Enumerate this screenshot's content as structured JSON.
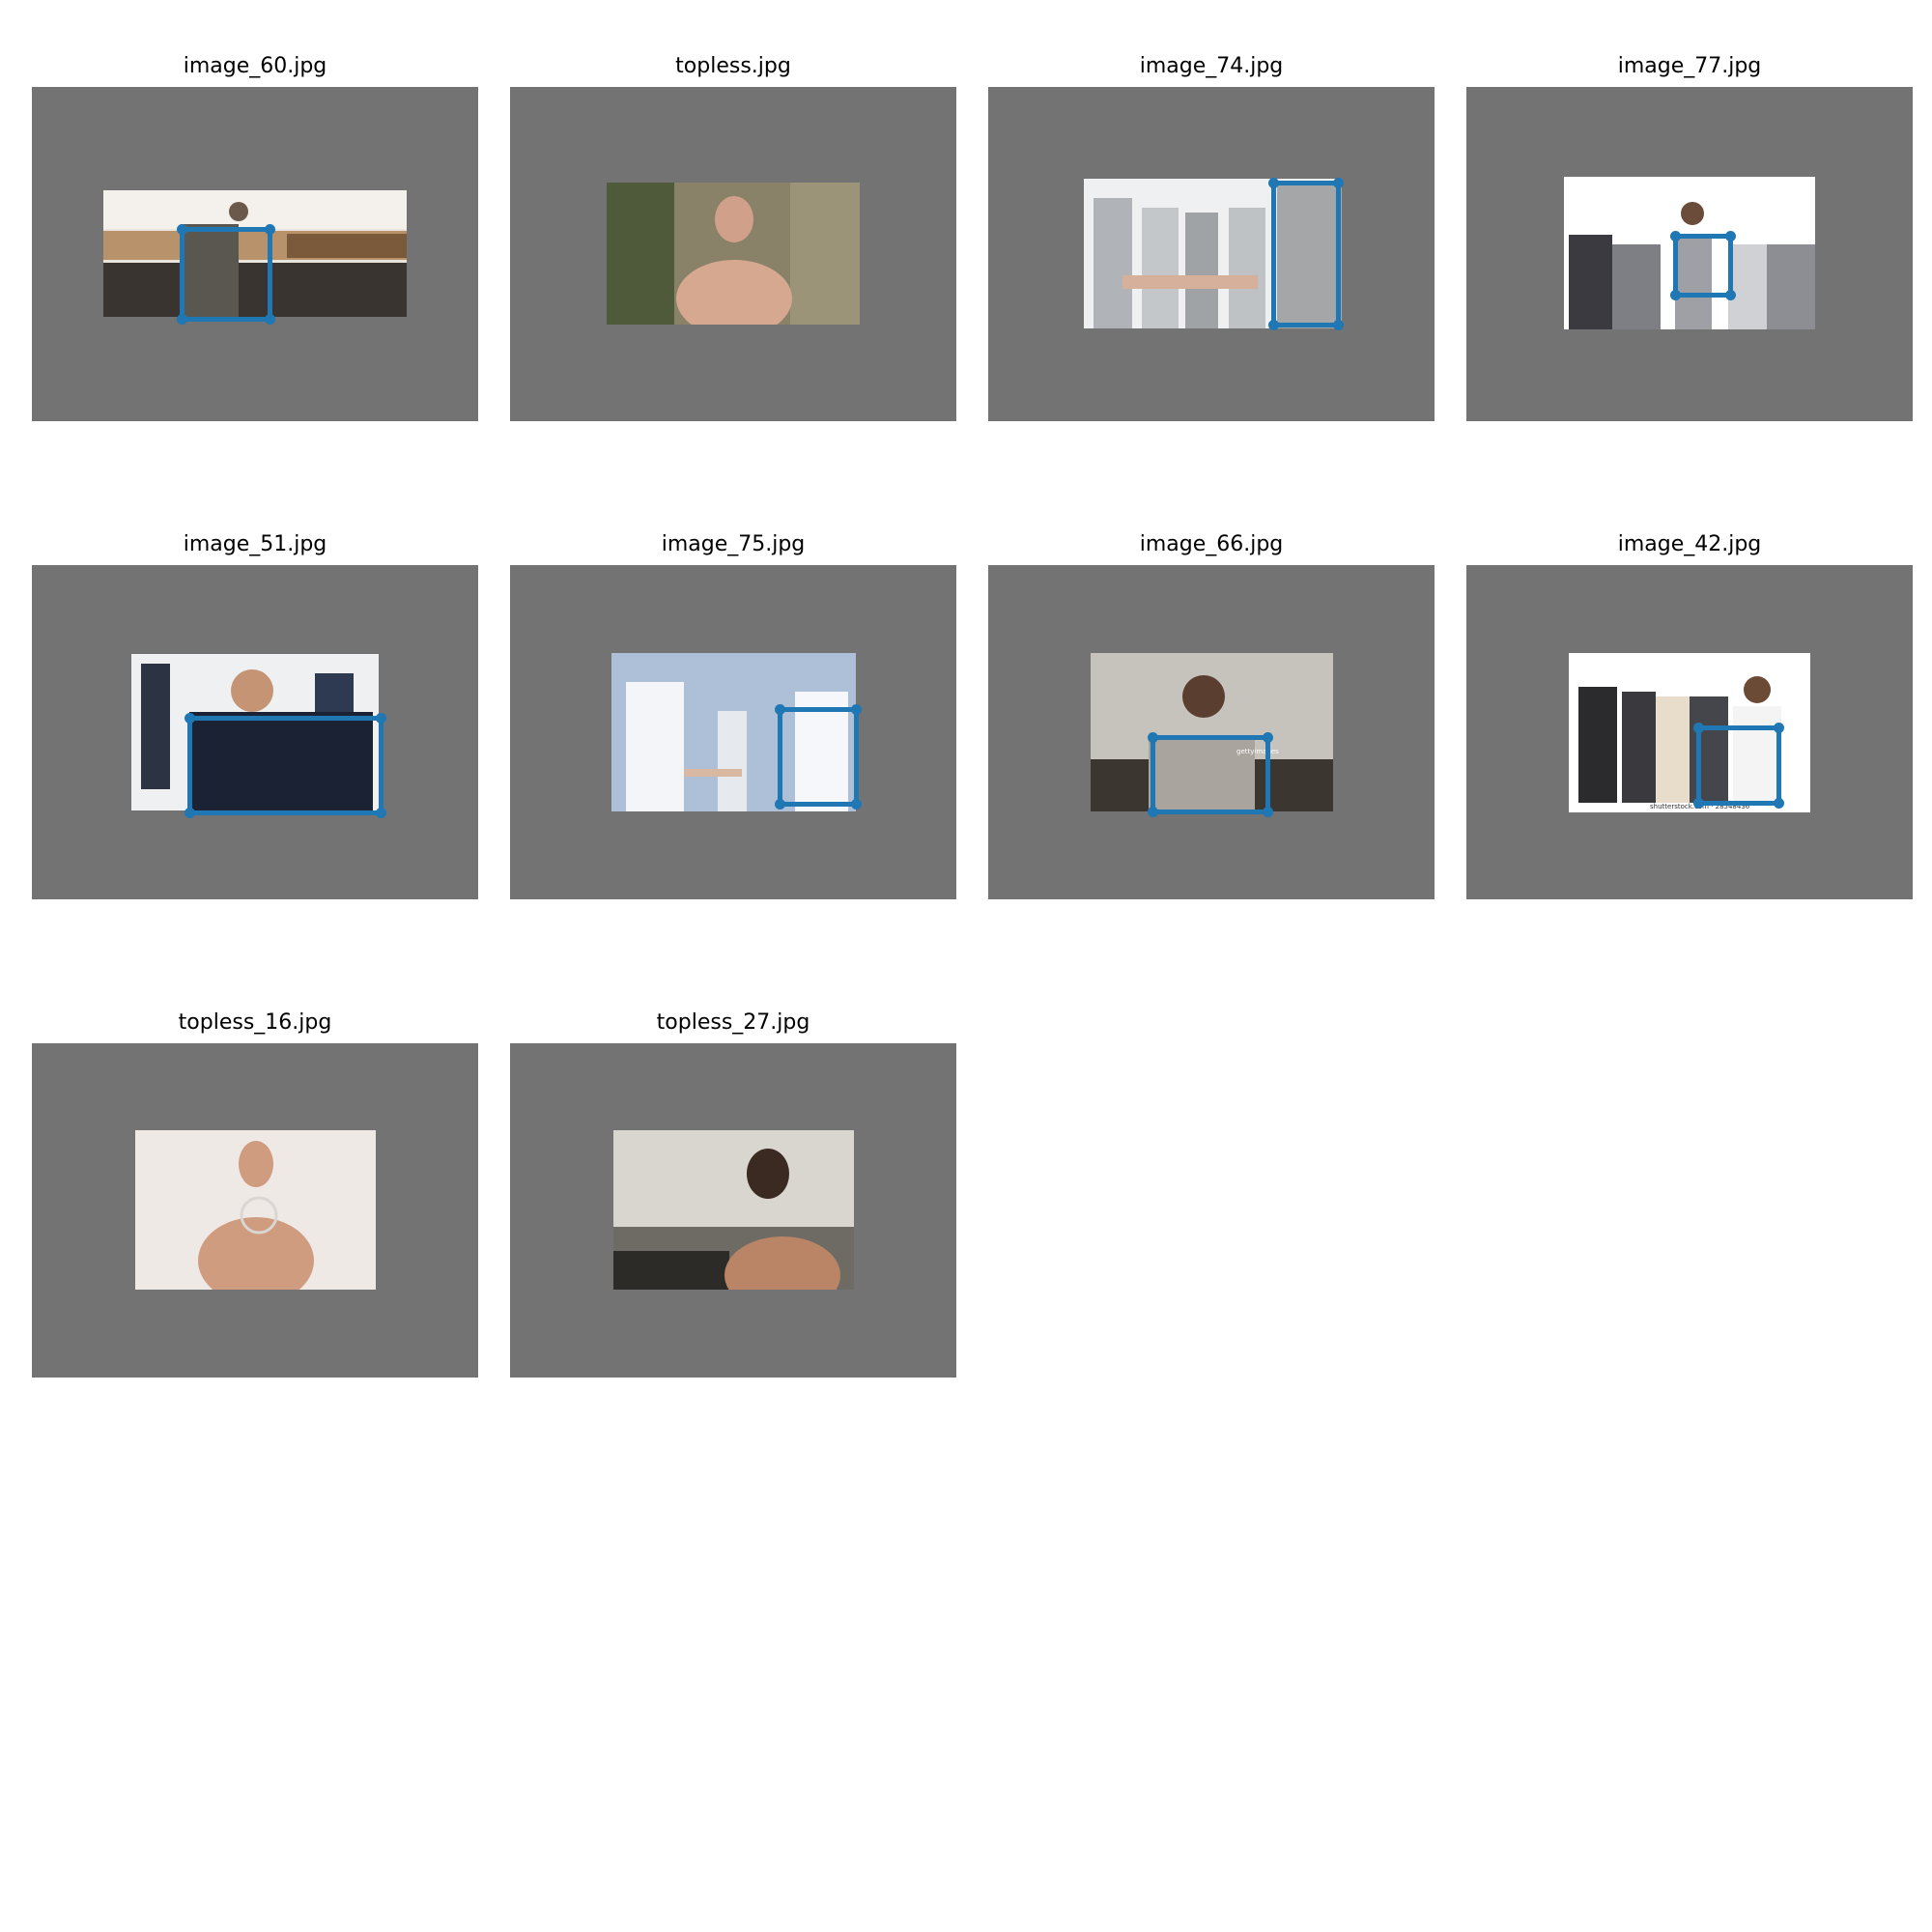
{
  "panels": [
    {
      "title": "image_60.jpg",
      "has_box": true
    },
    {
      "title": "topless.jpg",
      "has_box": false
    },
    {
      "title": "image_74.jpg",
      "has_box": true
    },
    {
      "title": "image_77.jpg",
      "has_box": true
    },
    {
      "title": "image_51.jpg",
      "has_box": true
    },
    {
      "title": "image_75.jpg",
      "has_box": true
    },
    {
      "title": "image_66.jpg",
      "has_box": true
    },
    {
      "title": "image_42.jpg",
      "has_box": true
    },
    {
      "title": "topless_16.jpg",
      "has_box": false
    },
    {
      "title": "topless_27.jpg",
      "has_box": false
    }
  ],
  "watermarks": {
    "image_66": "gettyimages",
    "image_42": "shutterstock.com · 28548436"
  },
  "colors": {
    "background": "#ffffff",
    "canvas": "#737373",
    "box": "#1f77b4"
  }
}
